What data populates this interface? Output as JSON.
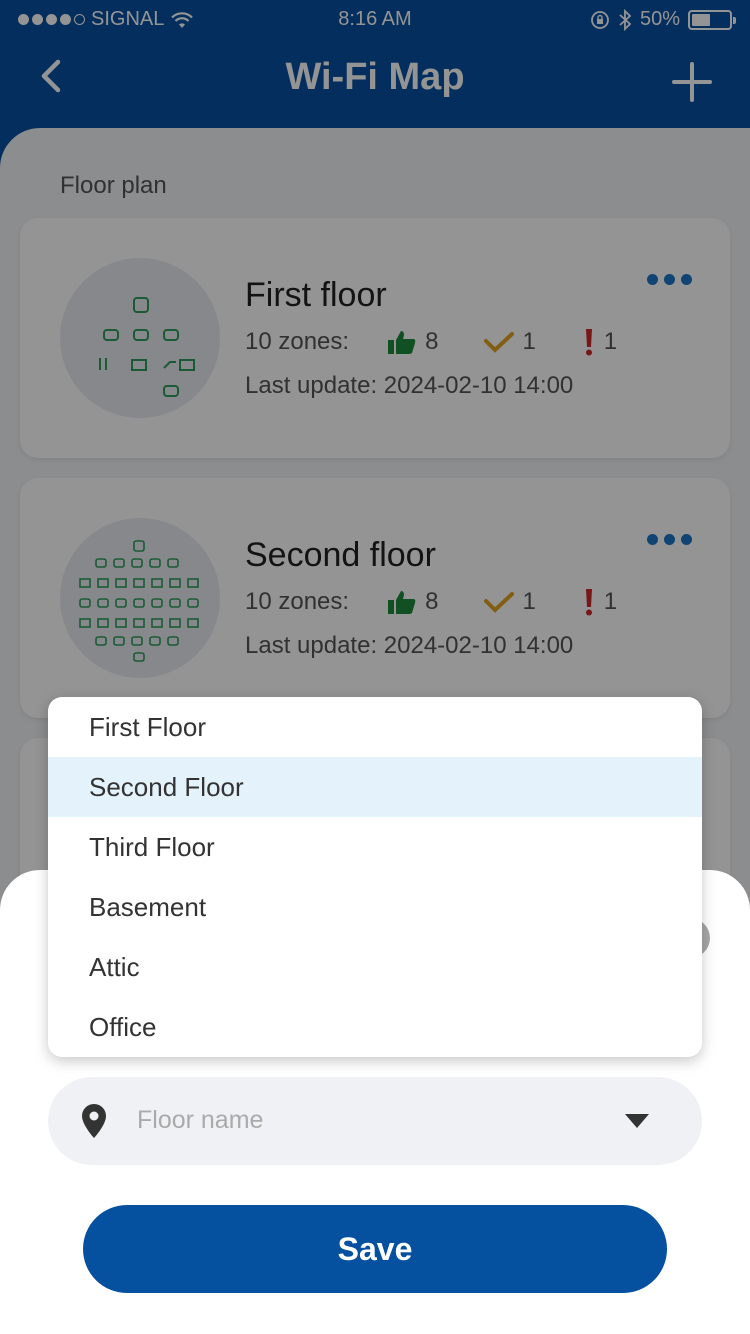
{
  "status_bar": {
    "carrier": "SIGNAL",
    "time": "8:16 AM",
    "battery": "50%",
    "battery_level": 0.5
  },
  "nav": {
    "title": "Wi-Fi Map",
    "back_icon": "chevron-left-icon",
    "add_icon": "plus-icon"
  },
  "floor_plan": {
    "section_label": "Floor plan",
    "cards": [
      {
        "title": "First floor",
        "zones_label": "10 zones:",
        "good": "8",
        "ok": "1",
        "warning": "1",
        "last_update": "Last update: 2024-02-10 14:00"
      },
      {
        "title": "Second floor",
        "zones_label": "10 zones:",
        "good": "8",
        "ok": "1",
        "warning": "1",
        "last_update": "Last update: 2024-02-10 14:00"
      }
    ]
  },
  "dropdown": {
    "options": [
      "First Floor",
      "Second Floor",
      "Third Floor",
      "Basement",
      "Attic",
      "Office"
    ],
    "selected": "Second Floor"
  },
  "sheet": {
    "floor_select_placeholder": "Floor name",
    "save_label": "Save"
  },
  "colors": {
    "brand": "#0650a0",
    "good": "#1e8a3c",
    "ok": "#e0a020",
    "warning": "#d02828",
    "selected_row": "#e4f3fb"
  }
}
